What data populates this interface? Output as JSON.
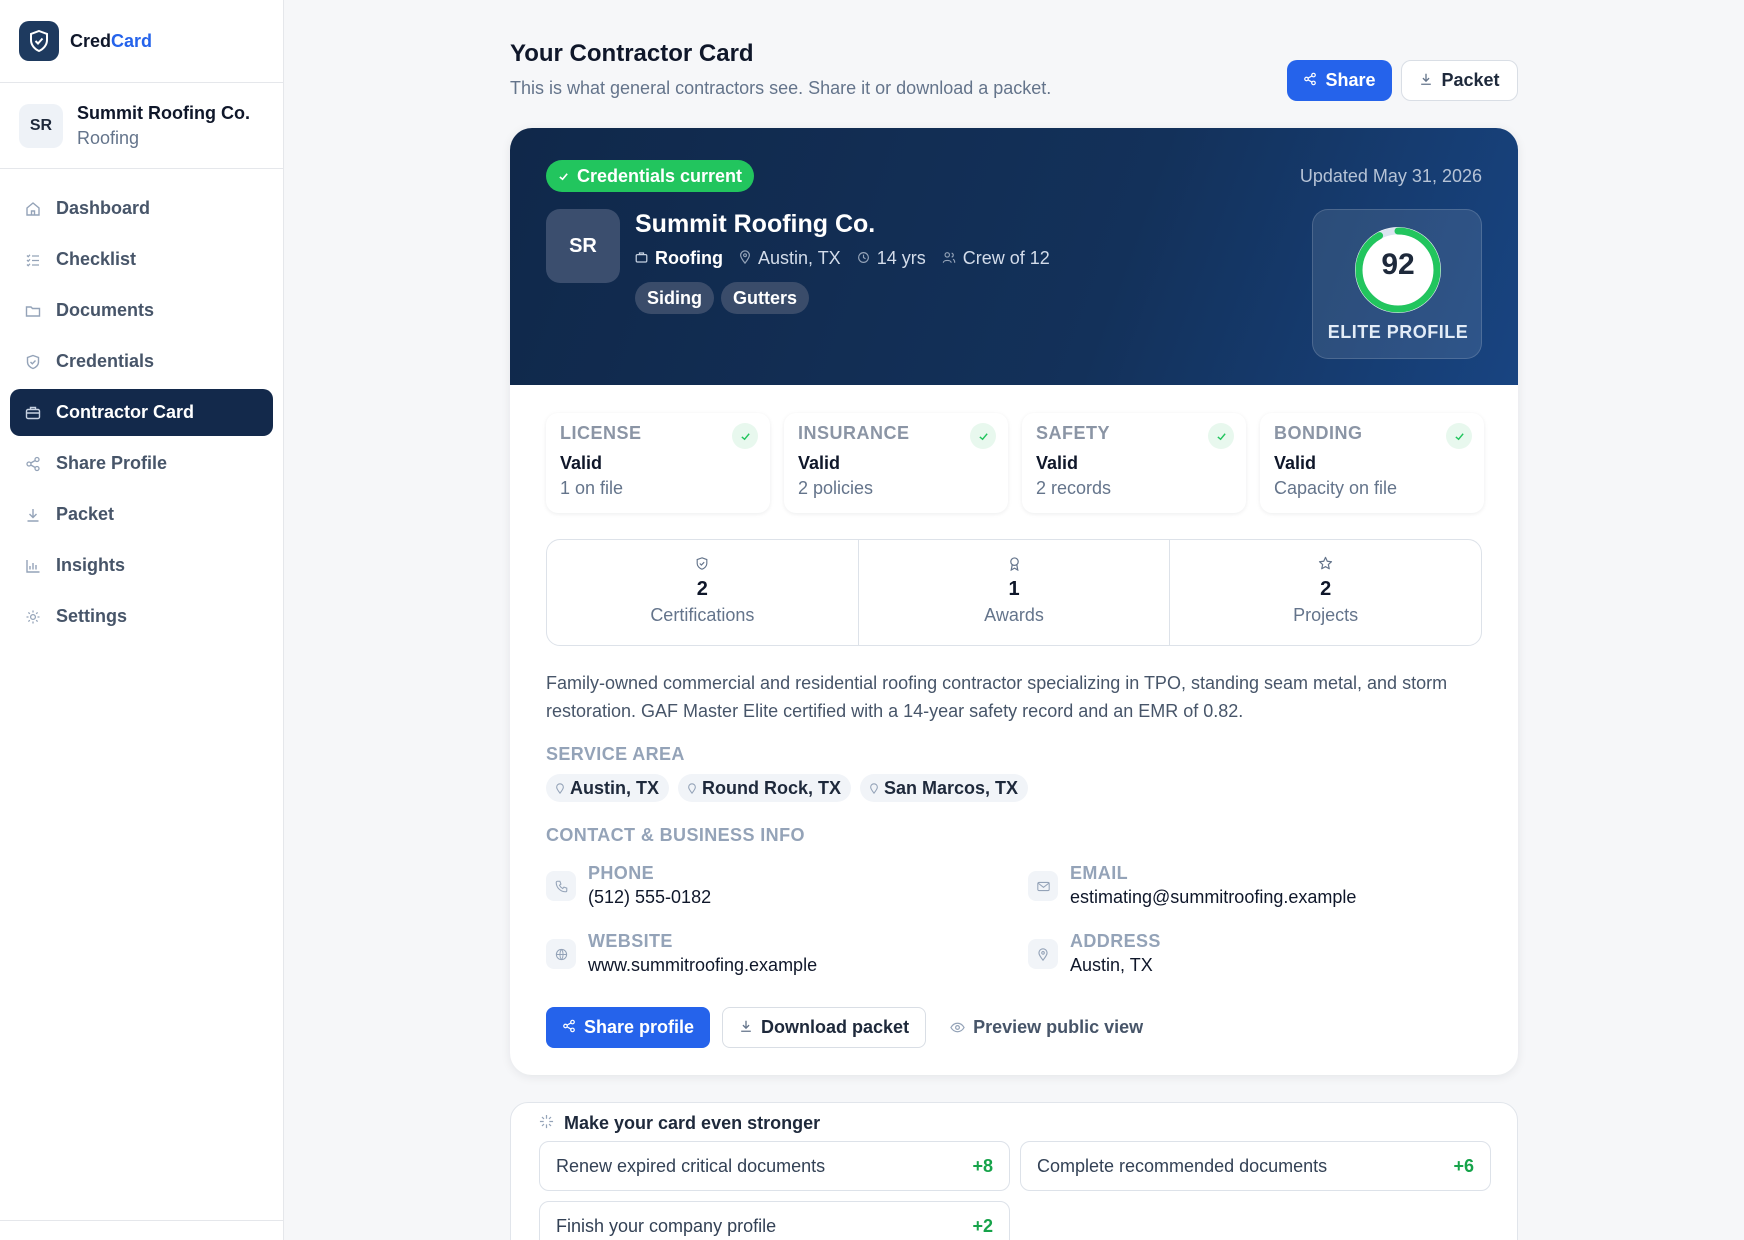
{
  "brand": {
    "name_a": "Cred",
    "name_b": "Card"
  },
  "company": {
    "initials": "SR",
    "name": "Summit Roofing Co.",
    "trade": "Roofing"
  },
  "nav": [
    {
      "label": "Dashboard",
      "icon": "home-icon"
    },
    {
      "label": "Checklist",
      "icon": "list-icon"
    },
    {
      "label": "Documents",
      "icon": "folder-icon"
    },
    {
      "label": "Credentials",
      "icon": "shield-icon"
    },
    {
      "label": "Contractor Card",
      "icon": "card-icon",
      "active": true
    },
    {
      "label": "Share Profile",
      "icon": "share-icon"
    },
    {
      "label": "Packet",
      "icon": "download-icon"
    },
    {
      "label": "Insights",
      "icon": "bar-chart-icon"
    },
    {
      "label": "Settings",
      "icon": "gear-icon"
    }
  ],
  "header": {
    "title": "Your Contractor Card",
    "subtitle": "This is what general contractors see. Share it or download a packet.",
    "share_label": "Share",
    "packet_label": "Packet"
  },
  "card": {
    "status": "Credentials current",
    "updated": "Updated May 31, 2026",
    "initials": "SR",
    "name": "Summit Roofing Co.",
    "trade": "Roofing",
    "location": "Austin, TX",
    "years": "14 yrs",
    "crew": "Crew of 12",
    "tags": [
      "Siding",
      "Gutters"
    ],
    "score": "92",
    "score_fraction": 0.92,
    "score_label": "ELITE PROFILE",
    "tiles": [
      {
        "title": "LICENSE",
        "value": "Valid",
        "sub": "1 on file"
      },
      {
        "title": "INSURANCE",
        "value": "Valid",
        "sub": "2 policies"
      },
      {
        "title": "SAFETY",
        "value": "Valid",
        "sub": "2 records"
      },
      {
        "title": "BONDING",
        "value": "Valid",
        "sub": "Capacity on file"
      }
    ],
    "stats": [
      {
        "num": "2",
        "label": "Certifications",
        "icon": "shield-check-icon"
      },
      {
        "num": "1",
        "label": "Awards",
        "icon": "award-icon"
      },
      {
        "num": "2",
        "label": "Projects",
        "icon": "star-icon"
      }
    ],
    "description": "Family-owned commercial and residential roofing contractor specializing in TPO, standing seam metal, and storm restoration. GAF Master Elite certified with a 14-year safety record and an EMR of 0.82.",
    "service_area_heading": "SERVICE AREA",
    "service_areas": [
      "Austin, TX",
      "Round Rock, TX",
      "San Marcos, TX"
    ],
    "contact_heading": "CONTACT & BUSINESS INFO",
    "contact": {
      "phone_label": "PHONE",
      "phone": "(512) 555-0182",
      "email_label": "EMAIL",
      "email": "estimating@summitroofing.example",
      "website_label": "WEBSITE",
      "website": "www.summitroofing.example",
      "address_label": "ADDRESS",
      "address": "Austin, TX"
    },
    "actions": {
      "share": "Share profile",
      "download": "Download packet",
      "preview": "Preview public view"
    }
  },
  "suggestions": {
    "title": "Make your card even stronger",
    "items": [
      {
        "label": "Renew expired critical documents",
        "points": "+8"
      },
      {
        "label": "Complete recommended documents",
        "points": "+6"
      },
      {
        "label": "Finish your company profile",
        "points": "+2"
      }
    ]
  },
  "colors": {
    "accent": "#2563eb",
    "navy": "#13294b",
    "success": "#22c55e"
  }
}
